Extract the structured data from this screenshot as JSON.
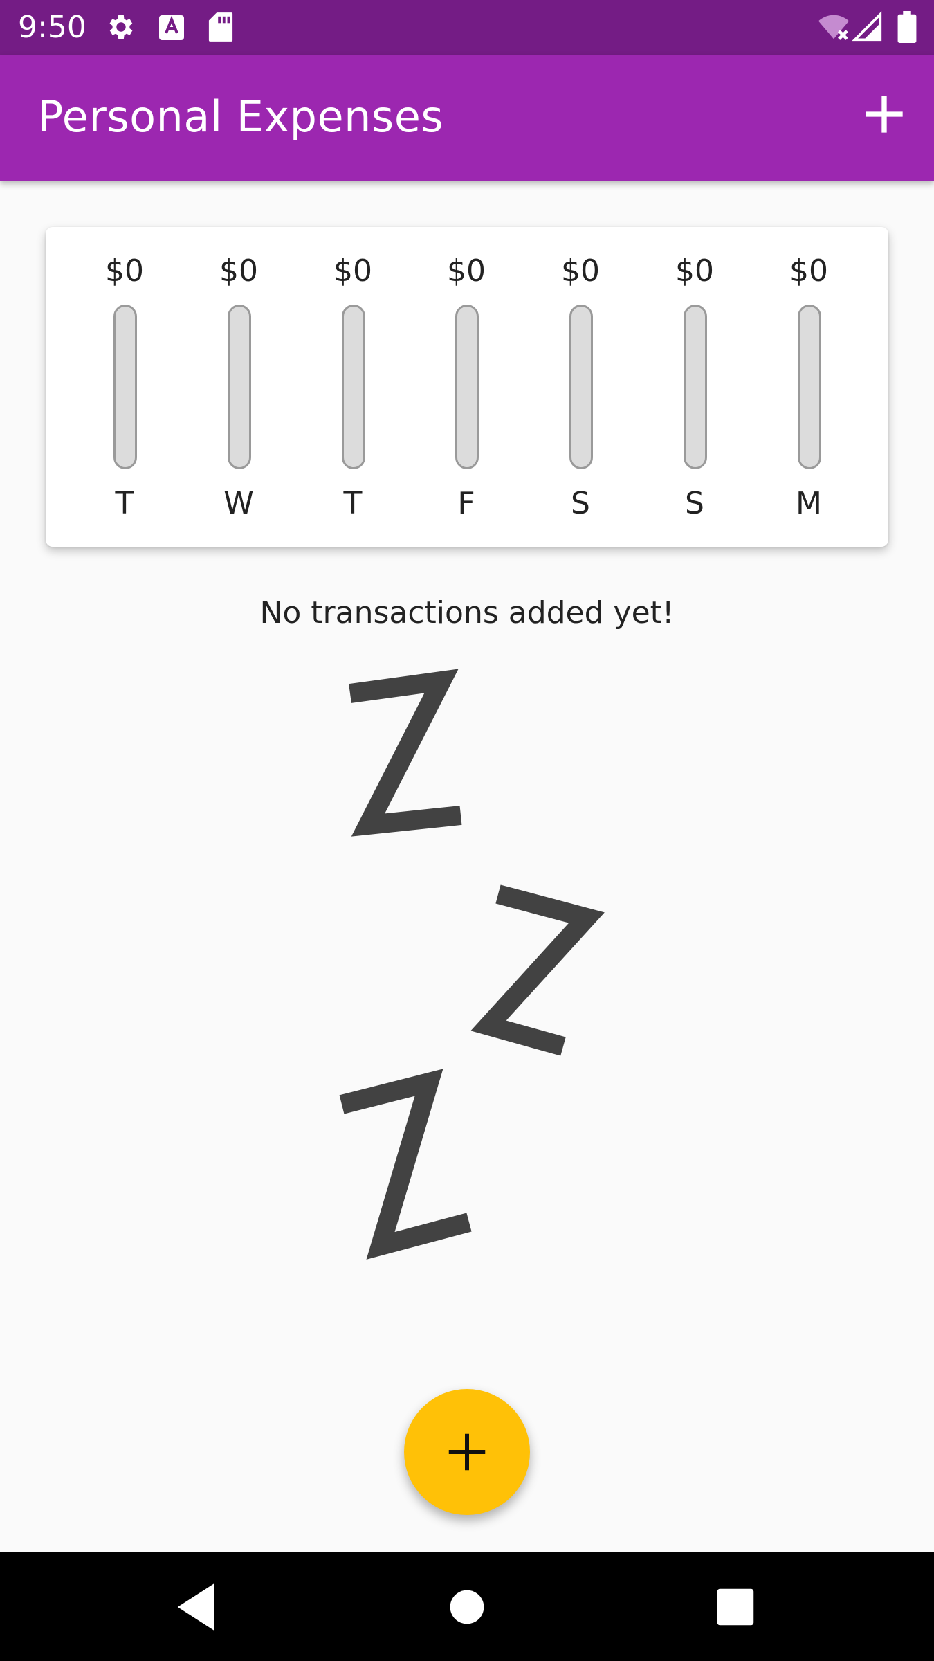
{
  "status_bar": {
    "time": "9:50",
    "icons": [
      "gear-icon",
      "font-a-icon",
      "sd-card-icon",
      "wifi-off-icon",
      "signal-icon",
      "battery-icon"
    ],
    "background": "#741c85"
  },
  "app_bar": {
    "title": "Personal Expenses",
    "action_icon": "plus-icon",
    "background": "#9c27b0"
  },
  "chart": {
    "days": [
      {
        "label": "T",
        "amount": "$0",
        "fraction": 0
      },
      {
        "label": "W",
        "amount": "$0",
        "fraction": 0
      },
      {
        "label": "T",
        "amount": "$0",
        "fraction": 0
      },
      {
        "label": "F",
        "amount": "$0",
        "fraction": 0
      },
      {
        "label": "S",
        "amount": "$0",
        "fraction": 0
      },
      {
        "label": "S",
        "amount": "$0",
        "fraction": 0
      },
      {
        "label": "M",
        "amount": "$0",
        "fraction": 0
      }
    ]
  },
  "empty_state": {
    "message": "No transactions added yet!",
    "image_icon": "sleep-zzz-icon"
  },
  "fab": {
    "icon": "plus-icon",
    "color": "#ffc107"
  },
  "nav_bar": {
    "buttons": [
      "back-icon",
      "home-icon",
      "recents-icon"
    ]
  }
}
